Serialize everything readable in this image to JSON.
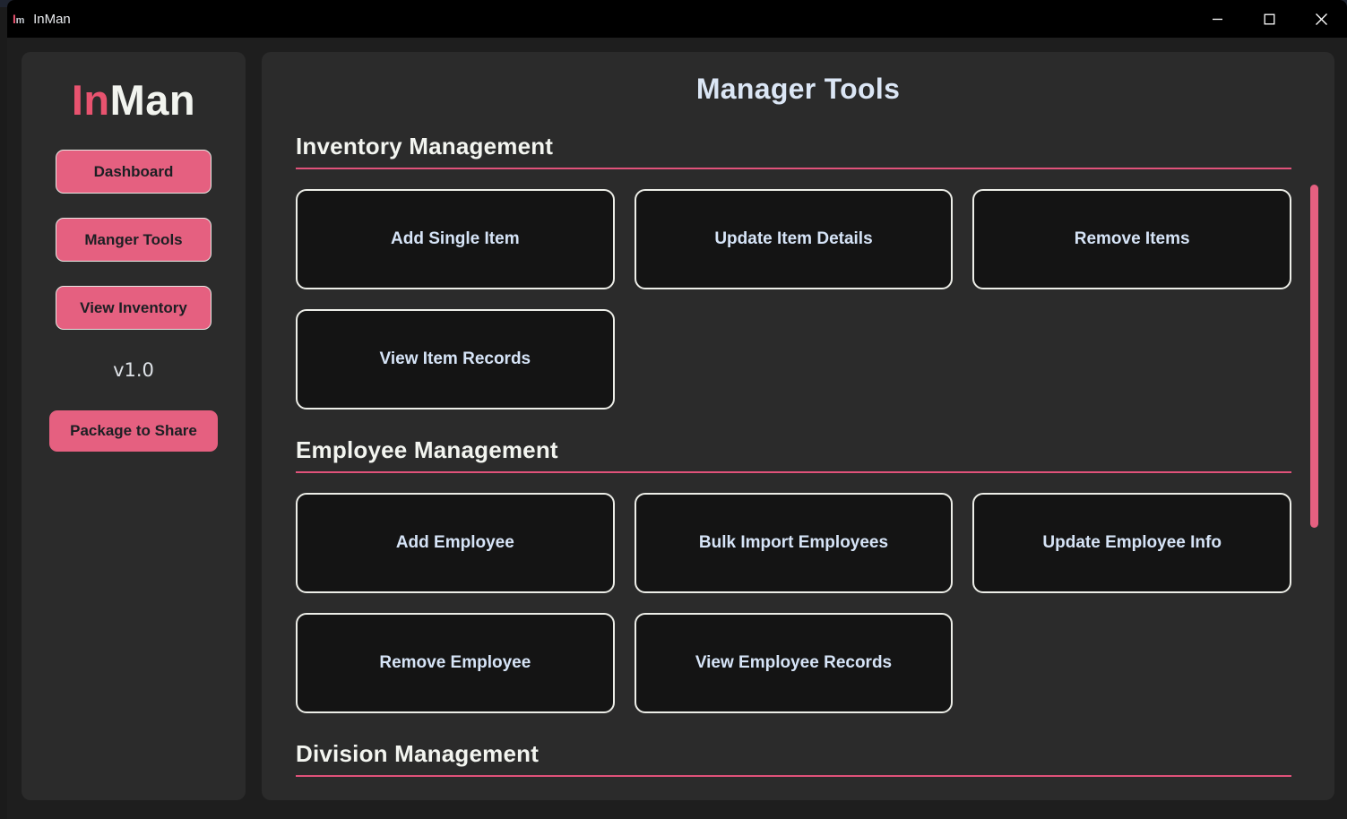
{
  "window": {
    "icon_primary": "I",
    "icon_secondary": "m",
    "title": "InMan",
    "controls": {
      "minimize": "minimize-icon",
      "maximize": "maximize-icon",
      "close": "close-icon"
    }
  },
  "sidebar": {
    "logo_primary": "In",
    "logo_secondary": "Man",
    "nav_items": [
      {
        "label": "Dashboard"
      },
      {
        "label": "Manger Tools"
      },
      {
        "label": "View Inventory"
      }
    ],
    "version": "v1.0",
    "package_button": "Package to Share"
  },
  "main": {
    "title": "Manager Tools",
    "sections": [
      {
        "title": "Inventory Management",
        "cards": [
          {
            "label": "Add Single Item"
          },
          {
            "label": "Update Item Details"
          },
          {
            "label": "Remove Items"
          },
          {
            "label": "View Item Records"
          }
        ]
      },
      {
        "title": "Employee Management",
        "cards": [
          {
            "label": "Add Employee"
          },
          {
            "label": "Bulk Import Employees"
          },
          {
            "label": "Update Employee Info"
          },
          {
            "label": "Remove Employee"
          },
          {
            "label": "View Employee Records"
          }
        ]
      },
      {
        "title": "Division Management",
        "cards": []
      }
    ]
  },
  "colors": {
    "accent": "#e56080",
    "accent_rule": "#e0527a",
    "panel_bg": "#2b2b2b",
    "window_bg": "#1e1e1e",
    "card_bg": "#141414",
    "card_border": "#edeee8",
    "card_text": "#d6e4f7",
    "title_text": "#dbe6f5"
  }
}
